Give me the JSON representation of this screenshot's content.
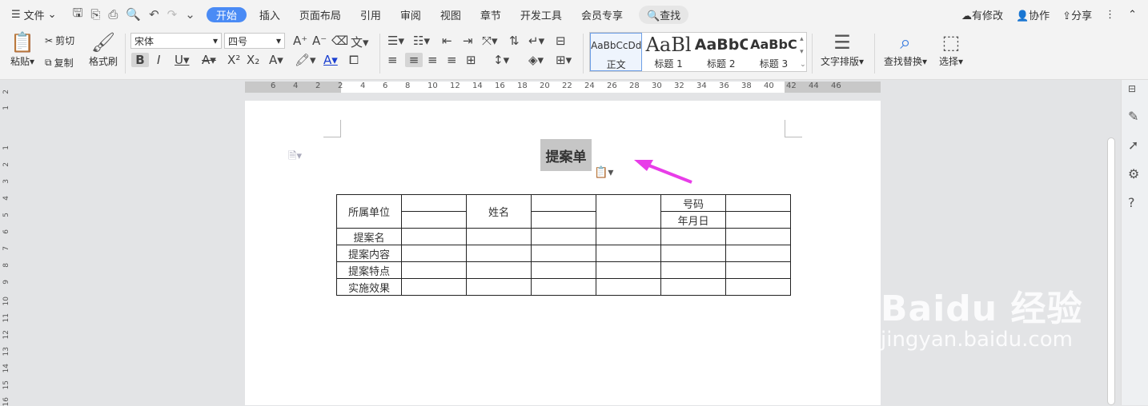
{
  "menubar": {
    "file": "文件",
    "tabs": [
      "开始",
      "插入",
      "页面布局",
      "引用",
      "审阅",
      "视图",
      "章节",
      "开发工具",
      "会员专享"
    ],
    "search": "查找",
    "right": {
      "modified": "有修改",
      "collab": "协作",
      "share": "分享"
    }
  },
  "ribbon": {
    "paste": "粘贴",
    "cut": "剪切",
    "copy": "复制",
    "format_painter": "格式刷",
    "font_name": "宋体",
    "font_size": "四号",
    "styles": [
      {
        "preview": "AaBbCcDd",
        "name": "正文"
      },
      {
        "preview": "AaBl",
        "name": "标题 1"
      },
      {
        "preview": "AaBbC",
        "name": "标题 2"
      },
      {
        "preview": "AaBbC",
        "name": "标题 3"
      }
    ],
    "text_layout": "文字排版",
    "find_replace": "查找替换",
    "select": "选择"
  },
  "ruler": {
    "marks": [
      "6",
      "4",
      "2",
      "2",
      "4",
      "6",
      "8",
      "10",
      "12",
      "14",
      "16",
      "18",
      "20",
      "22",
      "24",
      "26",
      "28",
      "30",
      "32",
      "34",
      "36",
      "38",
      "40",
      "42",
      "44",
      "46"
    ]
  },
  "vruler": {
    "marks": [
      "2",
      "1",
      "1",
      "2",
      "3",
      "4",
      "5",
      "6",
      "7",
      "8",
      "9",
      "10",
      "11",
      "12",
      "13",
      "14",
      "15",
      "16"
    ]
  },
  "document": {
    "title": "提案单",
    "table": {
      "unit_label": "所属单位",
      "name_label": "姓名",
      "number_label": "号码",
      "date_label": "年月日",
      "row_labels": [
        "提案名",
        "提案内容",
        "提案特点",
        "实施效果"
      ]
    }
  },
  "watermark": {
    "brand": "Baidu 经验",
    "url": "jingyan.baidu.com"
  },
  "colors": {
    "accent": "#4a8bf5",
    "arrow": "#e83de8"
  }
}
